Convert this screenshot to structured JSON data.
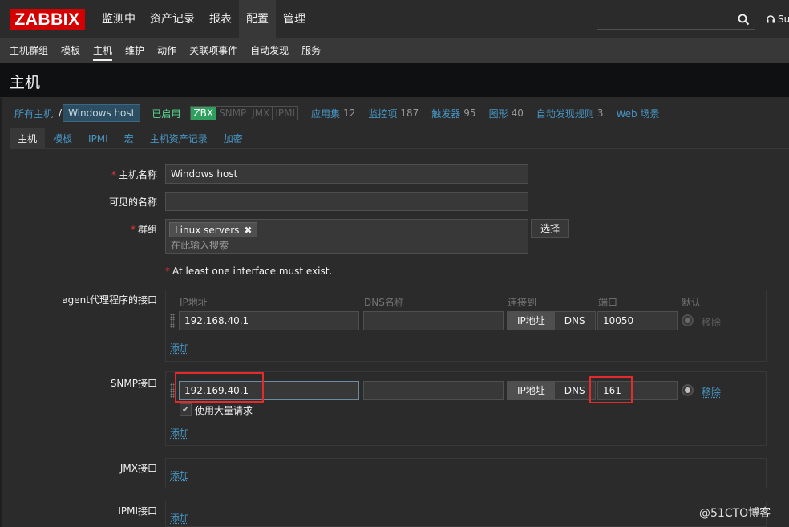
{
  "app": {
    "logo": "ZABBIX",
    "main_menu": [
      "监测中",
      "资产记录",
      "报表",
      "配置",
      "管理"
    ],
    "support_label": "Su",
    "sub_menu": [
      "主机群组",
      "模板",
      "主机",
      "维护",
      "动作",
      "关联项事件",
      "自动发现",
      "服务"
    ]
  },
  "page": {
    "title": "主机"
  },
  "breadcrumbs": {
    "all_hosts": "所有主机",
    "separator": "/",
    "current": "Windows host",
    "status": "已启用",
    "availability": [
      "ZBX",
      "SNMP",
      "JMX",
      "IPMI"
    ],
    "links": [
      {
        "label": "应用集",
        "count": "12"
      },
      {
        "label": "监控项",
        "count": "187"
      },
      {
        "label": "触发器",
        "count": "95"
      },
      {
        "label": "图形",
        "count": "40"
      },
      {
        "label": "自动发现规则",
        "count": "3"
      },
      {
        "label": "Web 场景",
        "count": ""
      }
    ]
  },
  "tabs": [
    "主机",
    "模板",
    "IPMI",
    "宏",
    "主机资产记录",
    "加密"
  ],
  "form": {
    "host_name_label": "主机名称",
    "host_name_value": "Windows host",
    "visible_name_label": "可见的名称",
    "visible_name_value": "",
    "groups_label": "群组",
    "group_chip": "Linux servers",
    "group_placeholder": "在此输入搜索",
    "select_button": "选择",
    "required_mark": "*",
    "interface_note": "At least one interface must exist.",
    "agent_label": "agent代理程序的接口",
    "snmp_label": "SNMP接口",
    "jmx_label": "JMX接口",
    "ipmi_label": "IPMI接口",
    "columns": {
      "ip": "IP地址",
      "dns": "DNS名称",
      "connect": "连接到",
      "port": "端口",
      "default": "默认"
    },
    "agent": {
      "ip": "192.168.40.1",
      "dns": "",
      "connect_ip": "IP地址",
      "connect_dns": "DNS",
      "port": "10050",
      "remove": "移除"
    },
    "snmp": {
      "ip": "192.169.40.1",
      "dns": "",
      "connect_ip": "IP地址",
      "connect_dns": "DNS",
      "port": "161",
      "remove": "移除",
      "bulk_label": "使用大量请求",
      "bulk_checked": true
    },
    "add_link": "添加"
  },
  "watermark": "@51CTO博客",
  "colors": {
    "brand_red": "#d40000",
    "link_blue": "#4796c4",
    "enabled_green": "#59db8f",
    "zbx_green": "#2f9f5e",
    "highlight_red": "#e32b2b"
  }
}
